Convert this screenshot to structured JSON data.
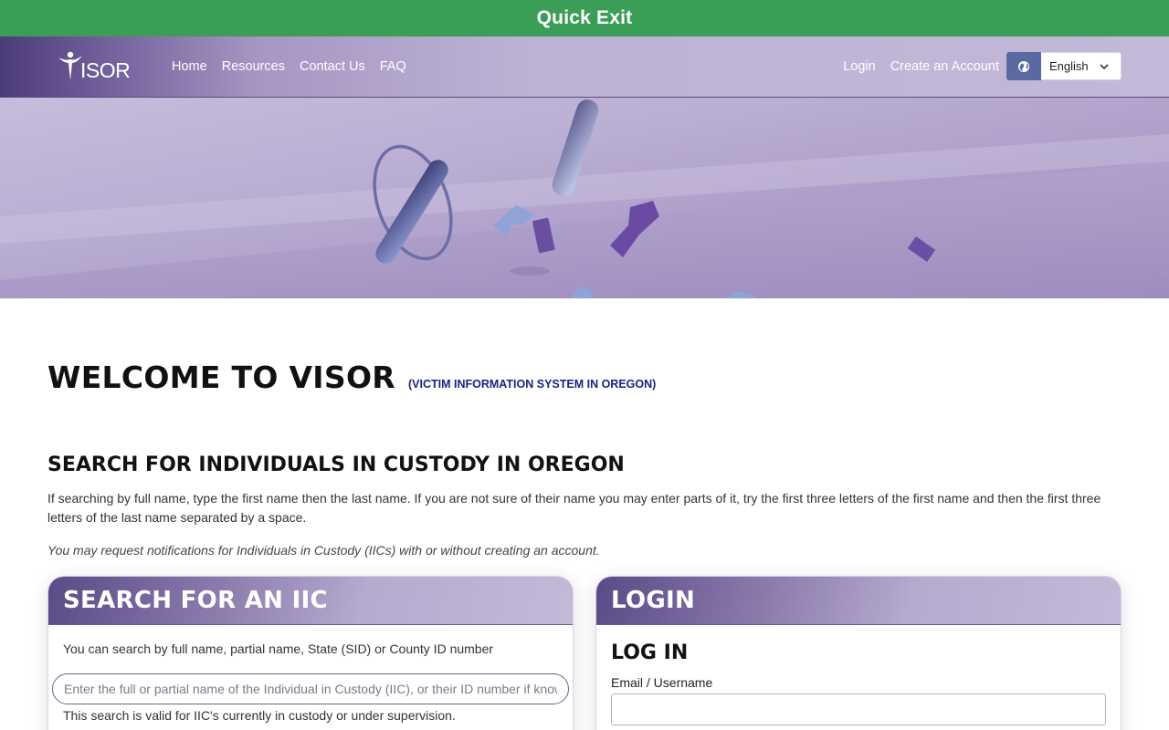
{
  "quick_exit": {
    "label": "Quick Exit"
  },
  "header": {
    "logo_text": "ISOR",
    "nav": [
      {
        "label": "Home"
      },
      {
        "label": "Resources"
      },
      {
        "label": "Contact Us"
      },
      {
        "label": "FAQ"
      }
    ],
    "login_label": "Login",
    "create_account_label": "Create an Account",
    "language": {
      "selected": "English",
      "icon": "globe-icon"
    }
  },
  "main": {
    "welcome_title": "WELCOME TO VISOR",
    "welcome_subtitle": "(VICTIM INFORMATION SYSTEM IN OREGON)",
    "search_title": "SEARCH FOR INDIVIDUALS IN CUSTODY IN OREGON",
    "intro_text": "If searching by full name, type the first name then the last name. If you are not sure of their name you may enter parts of it, try the first three letters of the first name and then the first three letters of the last name separated by a space.",
    "note_text": "You may request notifications for Individuals in Custody (IICs) with or without creating an account."
  },
  "search_card": {
    "title": "SEARCH FOR AN IIC",
    "hint": "You can search by full name, partial name, State (SID) or County ID number",
    "input_placeholder": "Enter the full or partial name of the Individual in Custody (IIC), or their ID number if known",
    "input_value": "",
    "validity_note": "This search is valid for IIC's currently in custody or under supervision."
  },
  "login_card": {
    "title": "LOGIN",
    "subtitle": "LOG IN",
    "email_label": "Email / Username",
    "email_value": ""
  },
  "colors": {
    "quick_exit_bg": "#3a9e56",
    "brand_purple": "#5a4a86",
    "link_navy": "#1a237e"
  }
}
